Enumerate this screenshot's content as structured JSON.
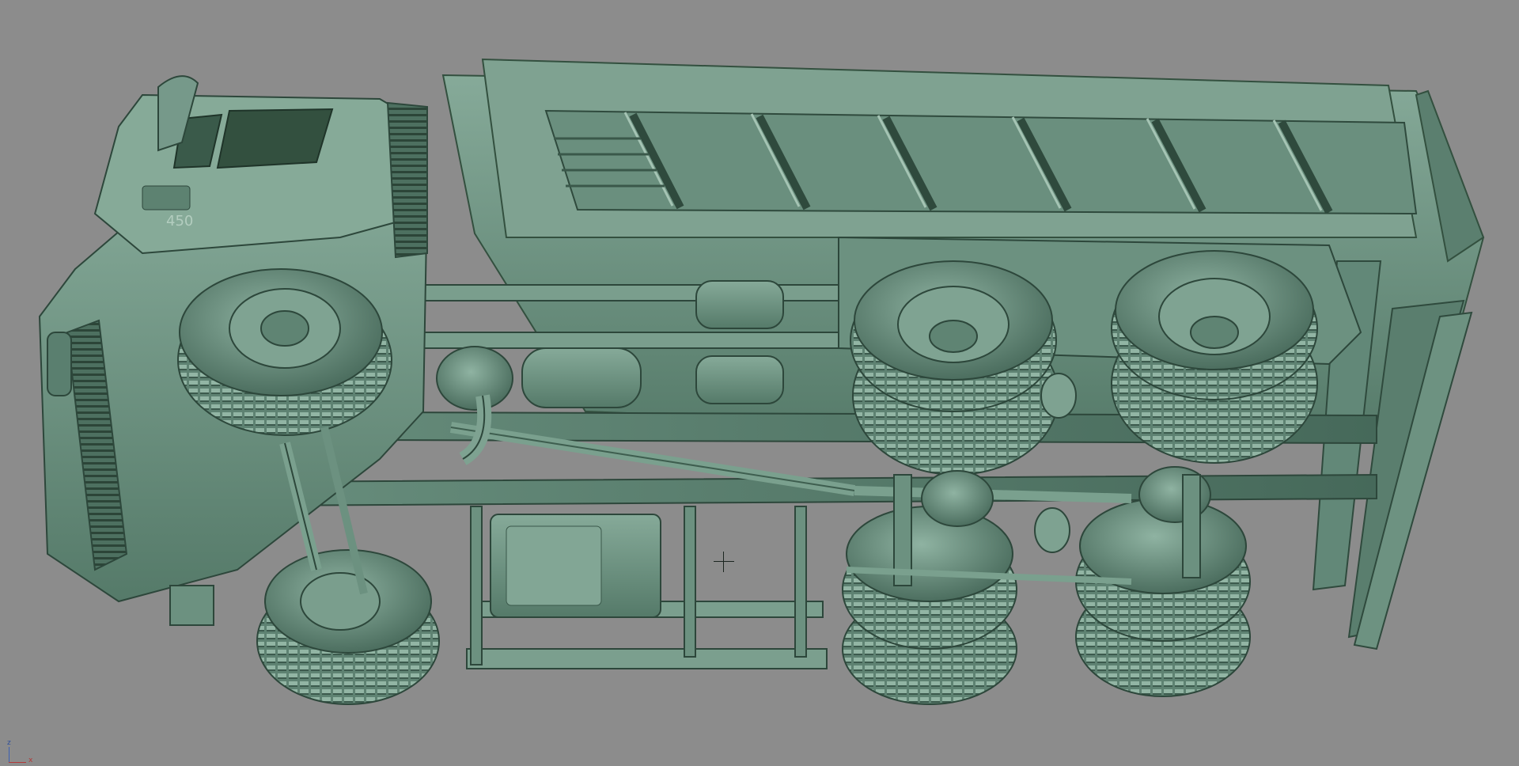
{
  "viewport": {
    "background_color": "#8c8c8c",
    "model_color": "#6f9484",
    "cab_badge": "450",
    "gizmo": {
      "z_label": "z",
      "x_label": "x"
    }
  }
}
